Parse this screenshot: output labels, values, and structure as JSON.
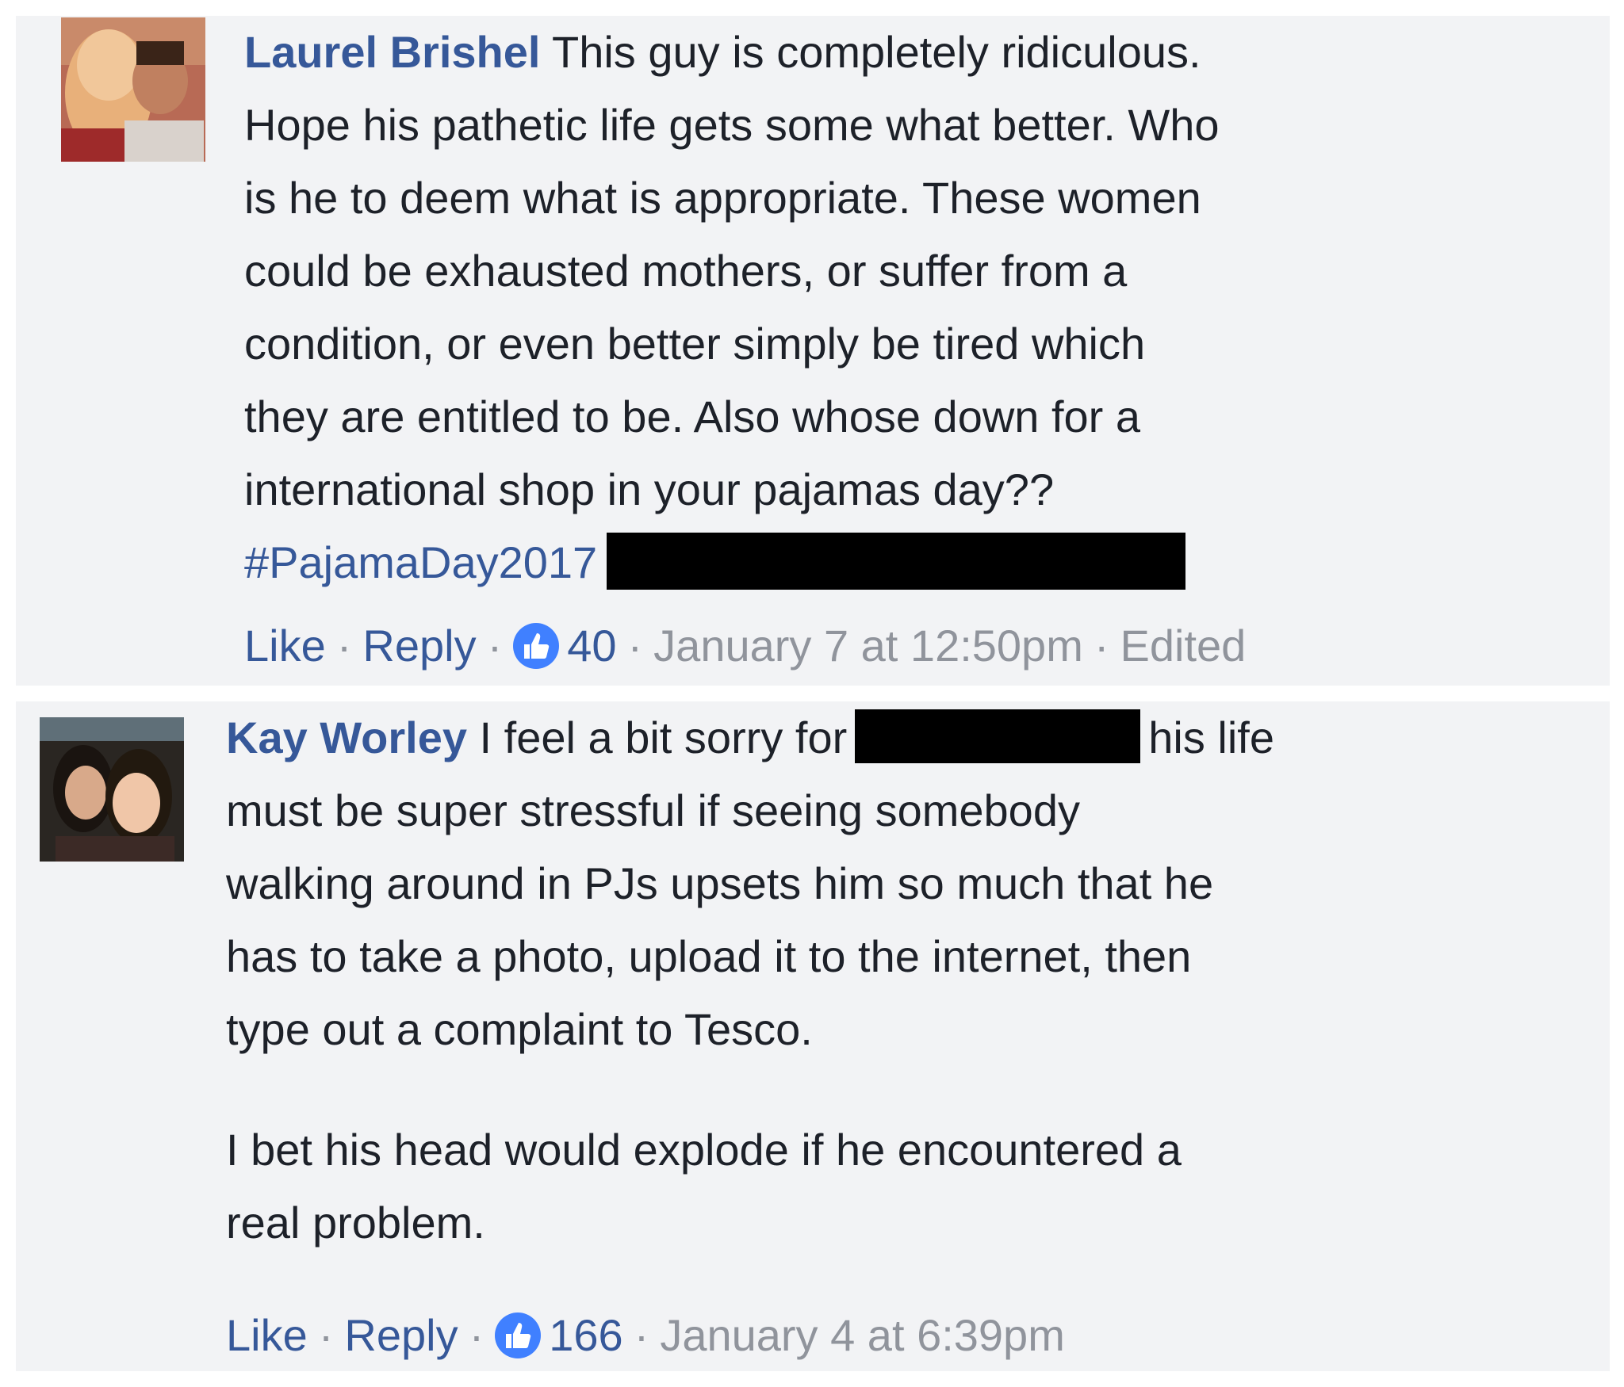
{
  "comments": [
    {
      "author": "Laurel Brishel",
      "lines": [
        "This guy is completely ridiculous.",
        "Hope his pathetic life gets some what better. Who",
        "is he to deem what is appropriate. These women",
        "could be exhausted mothers, or suffer from a",
        "condition, or even better simply be tired which",
        "they are entitled to be. Also whose down for a",
        "international shop in your pajamas day??"
      ],
      "hashtag": "#PajamaDay2017",
      "actions": {
        "like_label": "Like",
        "reply_label": "Reply",
        "reaction_count": "40",
        "timestamp": "January 7 at 12:50pm",
        "edited_label": "Edited"
      }
    },
    {
      "author": "Kay Worley",
      "first_line_before": "I feel a bit sorry for",
      "first_line_after": "his life",
      "lines": [
        "must be super stressful if seeing somebody",
        "walking around in PJs upsets him so much that he",
        "has to take a photo, upload it to the internet, then",
        "type out a complaint to Tesco."
      ],
      "paragraph2": [
        "I bet his head would explode if he encountered a",
        "real problem."
      ],
      "actions": {
        "like_label": "Like",
        "reply_label": "Reply",
        "reaction_count": "166",
        "timestamp": "January 4 at 6:39pm"
      }
    }
  ],
  "colors": {
    "panel_background": "#f2f3f5",
    "author_link": "#365899",
    "body_text": "#1d2129",
    "meta_text": "#90949c",
    "like_badge": "#4080ff",
    "redaction": "#000000"
  },
  "icons": {
    "like_badge": "thumbs-up-icon",
    "avatar": "profile-photo"
  }
}
